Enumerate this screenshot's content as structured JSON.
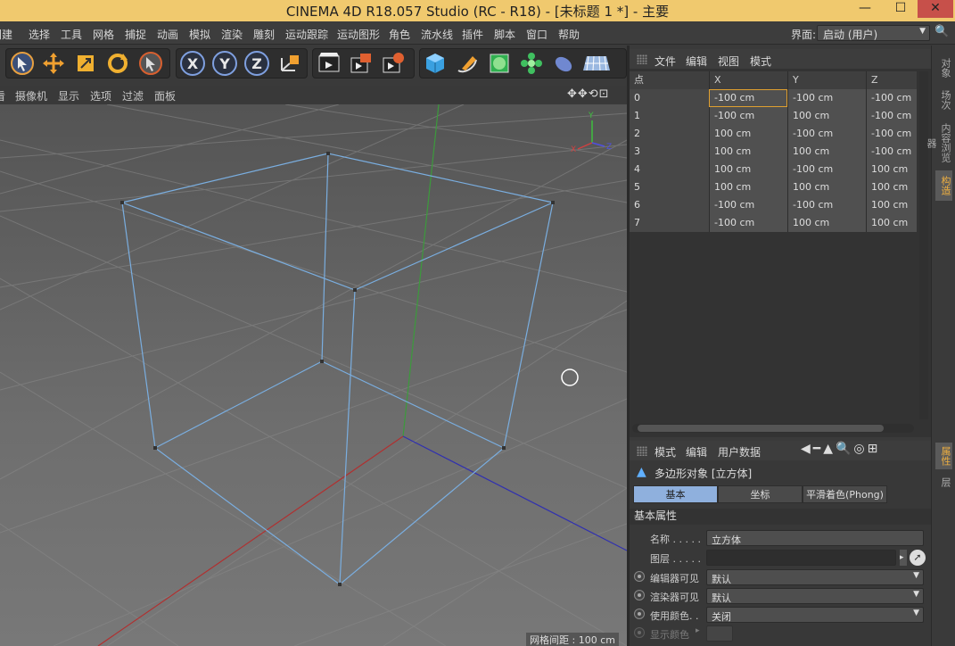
{
  "window": {
    "title": "CINEMA 4D R18.057 Studio (RC - R18) - [未标题 1 *] - 主要",
    "min": "—",
    "max": "☐",
    "close": "✕"
  },
  "menu": {
    "items": [
      "创建",
      "选择",
      "工具",
      "网格",
      "捕捉",
      "动画",
      "模拟",
      "渲染",
      "雕刻",
      "运动跟踪",
      "运动图形",
      "角色",
      "流水线",
      "插件",
      "脚本",
      "窗口",
      "帮助"
    ],
    "layout_label": "界面:",
    "layout_value": "启动 (用户)"
  },
  "viewport": {
    "menu": [
      "摄像机",
      "显示",
      "选项",
      "过滤",
      "面板"
    ],
    "nav_icons": "✥✥⟲⊡",
    "grid_status": "网格间距 : 100 cm",
    "axis_labels": {
      "y": "Y",
      "x": "X",
      "z": "Z"
    }
  },
  "structure": {
    "menu": [
      "文件",
      "编辑",
      "视图",
      "模式"
    ],
    "columns": [
      "点",
      "X",
      "Y",
      "Z"
    ],
    "rows": [
      [
        "0",
        "-100 cm",
        "-100 cm",
        "-100 cm"
      ],
      [
        "1",
        "-100 cm",
        "100 cm",
        "-100 cm"
      ],
      [
        "2",
        "100 cm",
        "-100 cm",
        "-100 cm"
      ],
      [
        "3",
        "100 cm",
        "100 cm",
        "-100 cm"
      ],
      [
        "4",
        "100 cm",
        "-100 cm",
        "100 cm"
      ],
      [
        "5",
        "100 cm",
        "100 cm",
        "100 cm"
      ],
      [
        "6",
        "-100 cm",
        "-100 cm",
        "100 cm"
      ],
      [
        "7",
        "-100 cm",
        "100 cm",
        "100 cm"
      ]
    ]
  },
  "right_tabs": [
    "对象",
    "场次",
    "内容浏览器",
    "构造"
  ],
  "right_tabs_bottom": [
    "属性",
    "层"
  ],
  "attributes": {
    "menu": [
      "模式",
      "编辑",
      "用户数据"
    ],
    "object_title": "多边形对象 [立方体]",
    "tabs": [
      "基本",
      "坐标",
      "平滑着色(Phong)"
    ],
    "section": "基本属性",
    "props": [
      {
        "label": "名称 . . . . .",
        "value": "立方体"
      },
      {
        "label": "图层 . . . . .",
        "value": ""
      },
      {
        "label": "编辑器可见",
        "value": "默认"
      },
      {
        "label": "渲染器可见",
        "value": "默认"
      },
      {
        "label": "使用颜色. .",
        "value": "关闭"
      },
      {
        "label": "显示颜色",
        "value": ""
      }
    ]
  }
}
